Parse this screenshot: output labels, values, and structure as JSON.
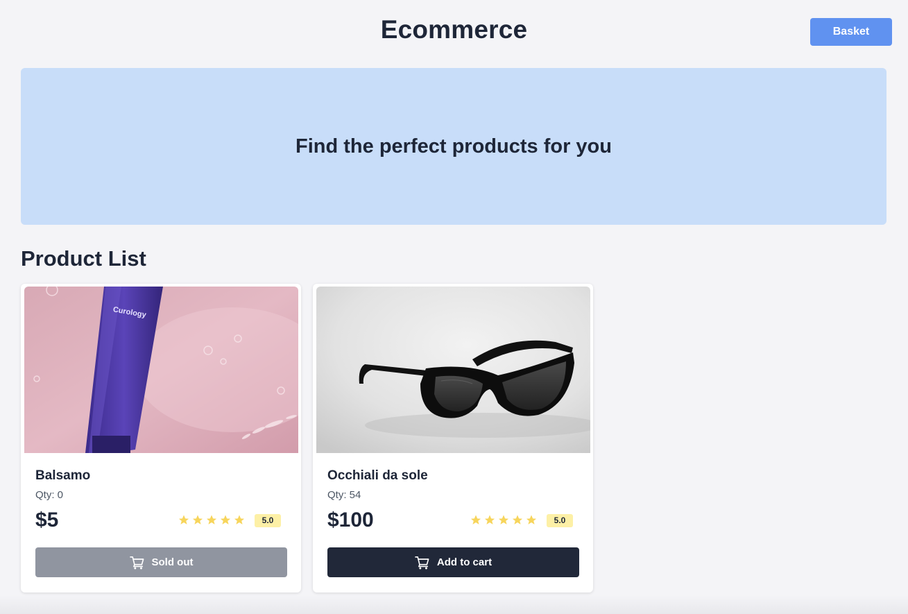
{
  "header": {
    "title": "Ecommerce",
    "basket_label": "Basket"
  },
  "hero": {
    "text": "Find the perfect products for you"
  },
  "section": {
    "title": "Product List"
  },
  "products": [
    {
      "name": "Balsamo",
      "qty_text": "Qty: 0",
      "price": "$5",
      "rating": "5.0",
      "stars": 5,
      "button_label": "Sold out",
      "button_enabled": false,
      "image_brand_text": "Curology",
      "image": "pink-background-purple-tube"
    },
    {
      "name": "Occhiali da sole",
      "qty_text": "Qty: 54",
      "price": "$100",
      "rating": "5.0",
      "stars": 5,
      "button_label": "Add to cart",
      "button_enabled": true,
      "image": "black-sunglasses-grey-background"
    }
  ],
  "icons": {
    "cart": "shopping-cart-icon",
    "star": "star-icon"
  },
  "colors": {
    "accent": "#6092f0",
    "hero_bg": "#c8ddf9",
    "button_dark": "#212839",
    "button_disabled": "#9095a0",
    "star": "#f7d55c",
    "rating_badge": "#fdf0a6"
  }
}
